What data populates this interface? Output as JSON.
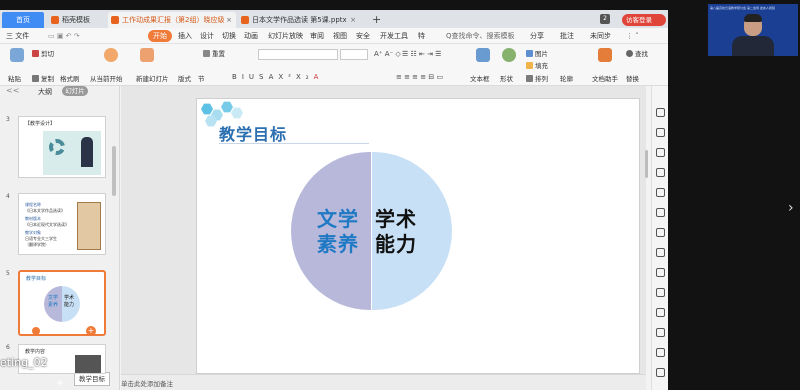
{
  "tabs": {
    "home": "首页",
    "template": "稻壳模板",
    "doc1": "工作动成果汇报（第2组）晓应级",
    "doc2": "日本文学作品选读 第5课.pptx",
    "add": "+",
    "count": "2",
    "guest": "访客登录"
  },
  "menu": {
    "file": "三 文件",
    "start": "开始",
    "insert": "插入",
    "design": "设计",
    "transition": "切换",
    "animation": "动画",
    "slideshow": "幻灯片放映",
    "review": "审阅",
    "view": "视图",
    "security": "安全",
    "devtools": "开发工具",
    "special": "特",
    "search": "Q查找命令、搜索模板",
    "share": "分享",
    "comment": "批注",
    "sync": "未同步"
  },
  "ribbon": {
    "paste": "粘贴",
    "cut": "剪切",
    "copy": "复制",
    "format_painter": "格式刷",
    "play_from_current": "从当前开始",
    "new_slide": "新建幻灯片",
    "layout": "版式",
    "section": "节",
    "reset": "重置",
    "textbox": "文本框",
    "shape": "形状",
    "picture": "图片",
    "fill": "填充",
    "arrange": "排列",
    "outline": "轮廓",
    "doc_assistant": "文档助手",
    "find": "查找",
    "replace": "替换",
    "font_format_buttons": [
      "B",
      "I",
      "U",
      "S",
      "A",
      "X²",
      "X₂",
      "A"
    ]
  },
  "left_panel": {
    "outline_tab": "大纲",
    "slides_tab": "幻灯片",
    "collapse": "<<",
    "thumbs": [
      {
        "num": "3",
        "title": "【教学设计】",
        "lines": []
      },
      {
        "num": "4",
        "title": "",
        "lines": [
          "课程名称",
          "《日本文学作品选读》",
          "教材版本",
          "《日本近现代文学选读》",
          "教学对象",
          "日语专业大三学生",
          "（翻译学院）"
        ]
      },
      {
        "num": "5",
        "title": "教学目标",
        "lines": [
          "文学",
          "素养",
          "学术",
          "能力"
        ]
      },
      {
        "num": "6",
        "title": "教学内容",
        "lines": []
      }
    ],
    "tooltip": "教学目标"
  },
  "slide": {
    "title": "教学目标",
    "left_text_1": "文学",
    "left_text_2": "素养",
    "right_text_1": "学术",
    "right_text_2": "能力"
  },
  "notes": {
    "hint": "单击此处添加备注"
  },
  "meeting": {
    "label": "eting_02"
  },
  "video": {
    "banner": "第八届高校日语教学研讨会 第二会场 发言人视频"
  },
  "colors": {
    "accent_orange": "#f07a38",
    "title_blue": "#2c6fb0",
    "circle_left": "#b7b8da",
    "circle_right": "#c8e0f5",
    "literature_text": "#1f79c4"
  }
}
